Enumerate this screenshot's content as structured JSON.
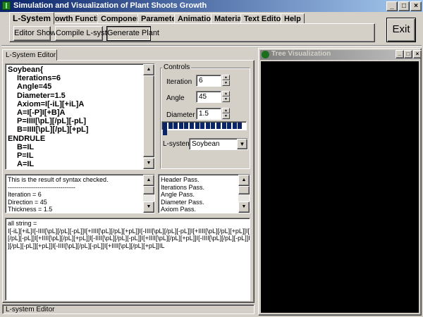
{
  "window": {
    "title": "Simulation and Visualization of Plant Shoots Growth",
    "minimize": "_",
    "maximize": "□",
    "close": "×"
  },
  "tabs": [
    "L-System",
    "Growth Function",
    "Component",
    "Parameter",
    "Animation",
    "Material",
    "Text Editor",
    "Help"
  ],
  "toolbar": {
    "editor_show": "Editor Show",
    "compile": "Compile L-system",
    "generate": "Generate Plant",
    "exit": "Exit"
  },
  "editor": {
    "tab_label": "L-System Editor",
    "code_lines": [
      "Soybean{",
      "Iterations=6",
      "Angle=45",
      "Diameter=1.5",
      "Axiom=I[-iL][+iL]A",
      "A=I[-P]I[+B]A",
      "P=IIII[\\pL][/pL][-pL]",
      "B=IIII[\\pL][/pL][+pL]",
      "ENDRULE",
      "B=IL",
      "P=IL",
      "A=IL"
    ],
    "syntax_lines": [
      "This is the result of syntax checked.",
      "--------------------------------",
      "Iteration = 6",
      "Direction = 45",
      "Thickness = 1.5"
    ],
    "check_lines": [
      "Header Pass.",
      "Iterations Pass.",
      "Angle Pass.",
      "Diameter Pass.",
      "Axiom Pass."
    ],
    "output_lines": [
      "all string =",
      "I[-iL][+iL]I[-IIII[\\pL][/pL][-pL]]I[+IIII[\\pL][/pL][+pL]]I[-IIII[\\pL][/pL][-pL]]I[+IIII[\\pL][/pL][+pL]]I[-IIII[\\pL]",
      "[/pL][-pL]]I[+IIII[\\pL][/pL][+pL]]I[-IIII[\\pL][/pL][-pL]]I[+IIII[\\pL][/pL][+pL]]I[-IIII[\\pL][/pL][-pL]]I[+IIII[\\pL",
      "][/pL][-pL]][+pL]]I[-IIII[\\pL][/pL][-pL]]I[+IIII[\\pL][/pL][+pL]]IL"
    ],
    "status": "L-system Editor"
  },
  "controls": {
    "legend": "Controls",
    "iteration_label": "Iteration",
    "iteration_value": "6",
    "angle_label": "Angle",
    "angle_value": "45",
    "diameter_label": "Diameter",
    "diameter_value": "1.5",
    "progress": 1.0,
    "lsystems_label": "L-systems",
    "lsystems_value": "Soybean"
  },
  "viz": {
    "title": "Tree Visualization"
  },
  "colors": {
    "titlebar": "#0a246a",
    "face": "#d4d0c8",
    "progress": "#0a246a",
    "canvas": "#000000"
  }
}
